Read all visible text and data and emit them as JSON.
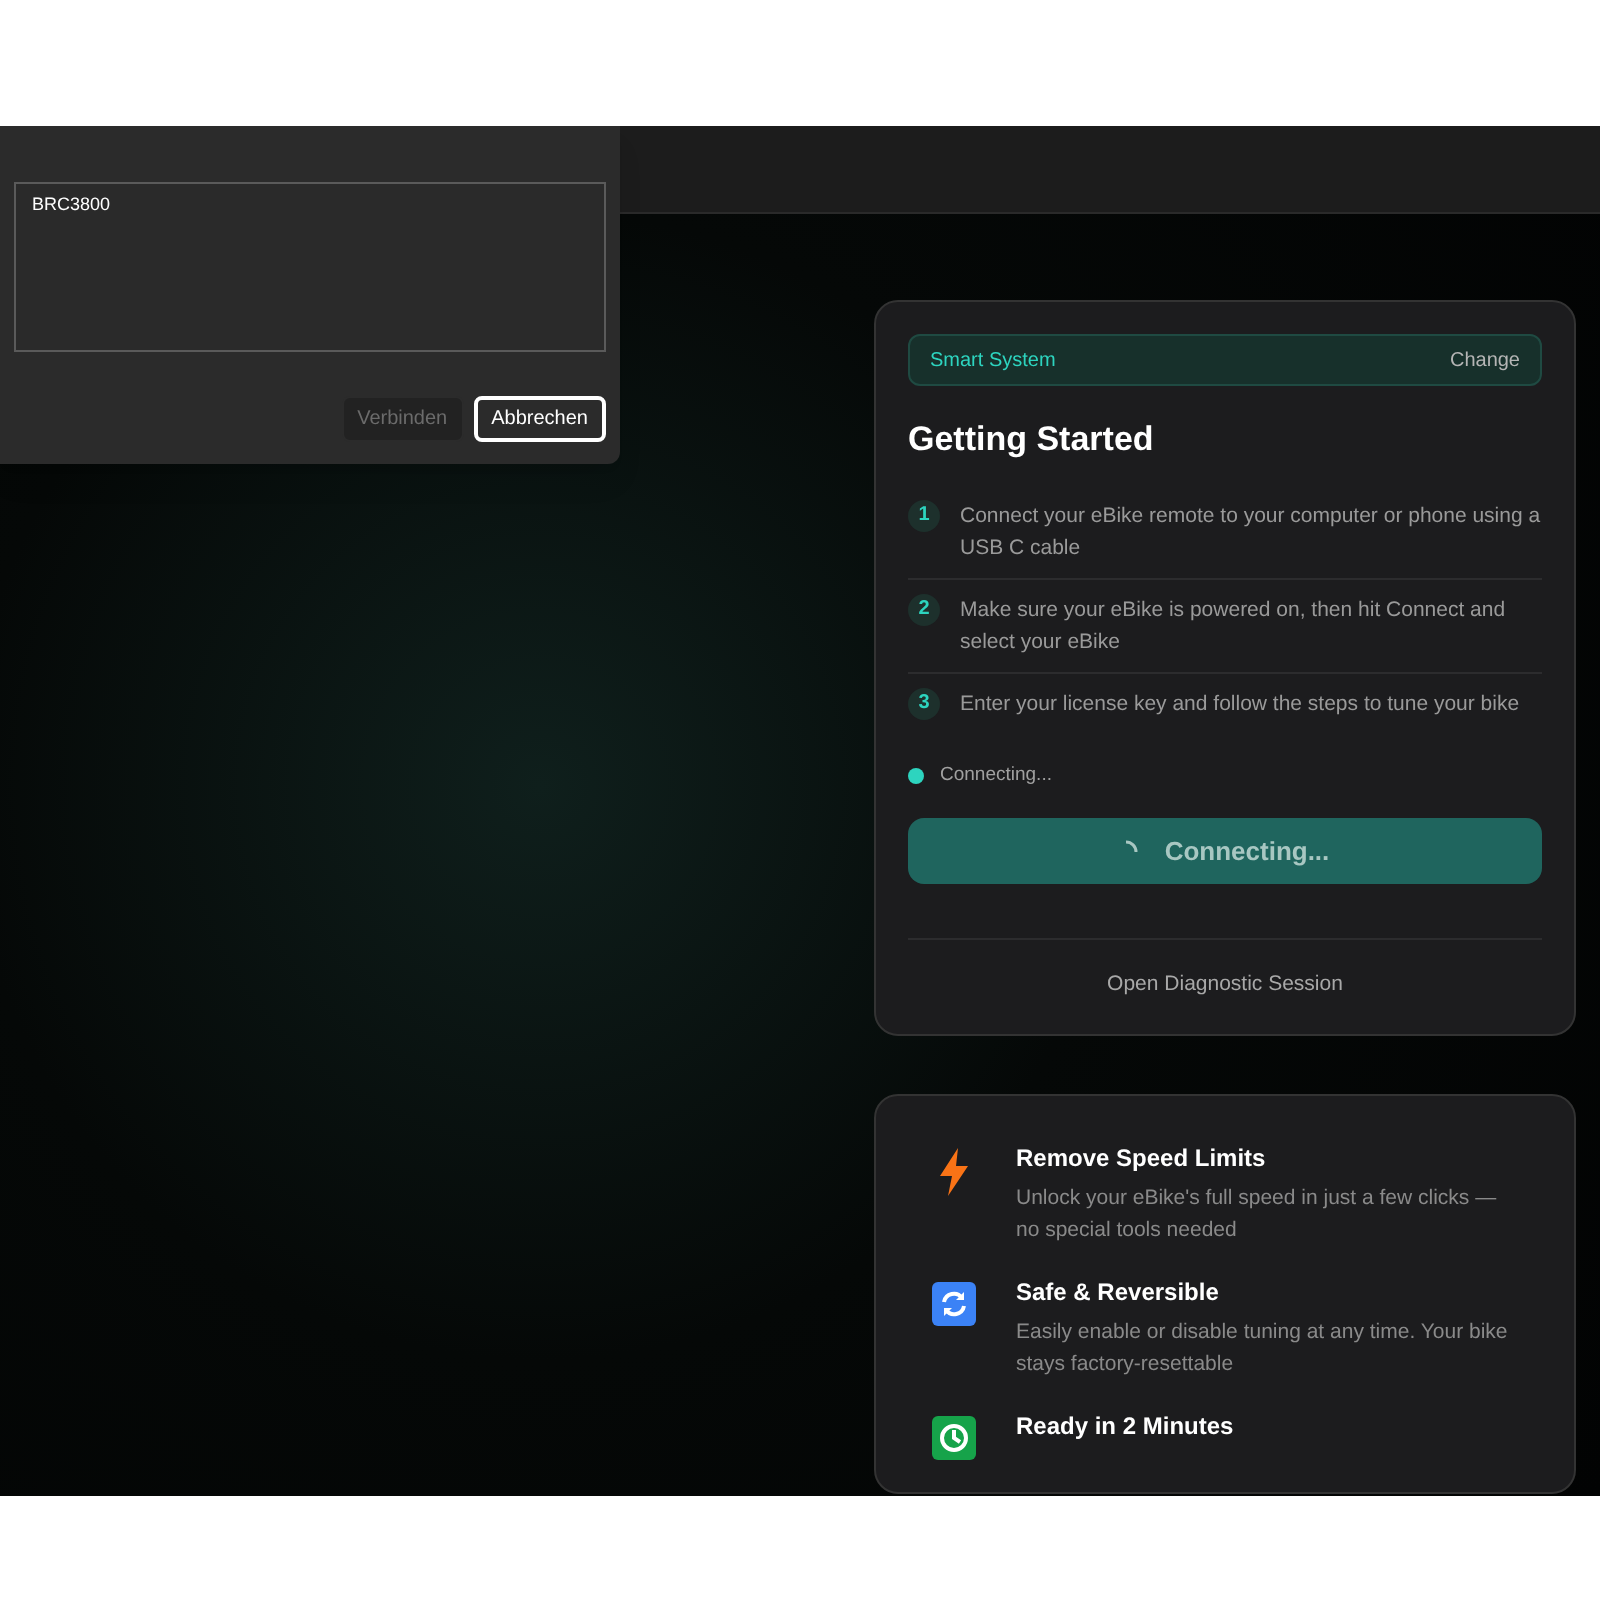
{
  "dialog": {
    "device_list": [
      "BRC3800"
    ],
    "buttons": [
      {
        "label": "Verbinden",
        "disabled": true,
        "focused": false
      },
      {
        "label": "Abbrechen",
        "disabled": false,
        "focused": true
      }
    ]
  },
  "setup_card": {
    "system": {
      "label": "Smart System",
      "action": "Change"
    },
    "title": "Getting Started",
    "steps": [
      {
        "number": "1",
        "text": "Connect your eBike remote to your computer or phone using a USB C cable"
      },
      {
        "number": "2",
        "text": "Make sure your eBike is powered on, then hit Connect and select your eBike"
      },
      {
        "number": "3",
        "text": "Enter your license key and follow the steps to tune your bike"
      }
    ],
    "status": "Connecting...",
    "connect_button": {
      "label": "Connecting...",
      "loading": true
    },
    "diagnostic_link": "Open Diagnostic Session"
  },
  "features": [
    {
      "kind": "bolt",
      "title": "Remove Speed Limits",
      "text": "Unlock your eBike's full speed in just a few clicks — no special tools needed"
    },
    {
      "kind": "refresh",
      "title": "Safe & Reversible",
      "text": "Easily enable or disable tuning at any time. Your bike stays factory-resettable"
    },
    {
      "kind": "clock",
      "title": "Ready in 2 Minutes"
    }
  ]
}
